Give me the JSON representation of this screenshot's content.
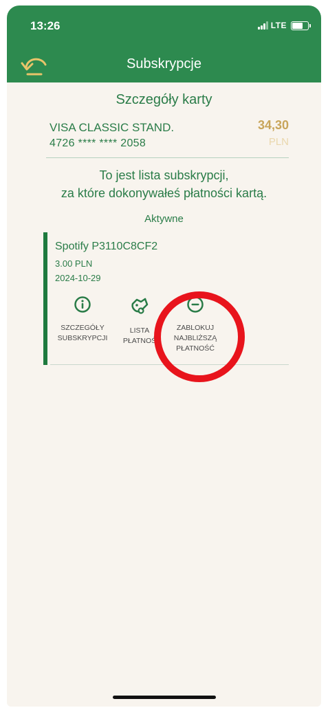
{
  "status_bar": {
    "time": "13:26",
    "network": "LTE"
  },
  "header": {
    "title": "Subskrypcje",
    "back_icon": "back-arrow-icon"
  },
  "card_details": {
    "section_title": "Szczegóły karty",
    "card_name": "VISA CLASSIC STAND.",
    "card_number": "4726 **** **** 2058",
    "amount": "34,30",
    "currency": "PLN"
  },
  "info": {
    "line1": "To jest lista subskrypcji,",
    "line2": "za które dokonywałeś płatności kartą."
  },
  "active_label": "Aktywne",
  "subscription": {
    "name": "Spotify P3110C8CF2",
    "amount": "3.00 PLN",
    "date": "2024-10-29",
    "actions": [
      {
        "label": "SZCZEGÓŁY\nSUBSKRYPCJI",
        "icon": "info-icon"
      },
      {
        "label": "LISTA\nPŁATNOŚ",
        "icon": "payment-list-icon"
      },
      {
        "label": "ZABLOKUJ\nNAJBLIŻSZĄ\nPŁATNOŚĆ",
        "icon": "block-icon"
      }
    ]
  },
  "colors": {
    "header": "#2d8a4f",
    "text_green": "#2a7c48",
    "amount_gold": "#c8a55a",
    "highlight_red": "#e8141c",
    "background": "#f8f4ee"
  }
}
